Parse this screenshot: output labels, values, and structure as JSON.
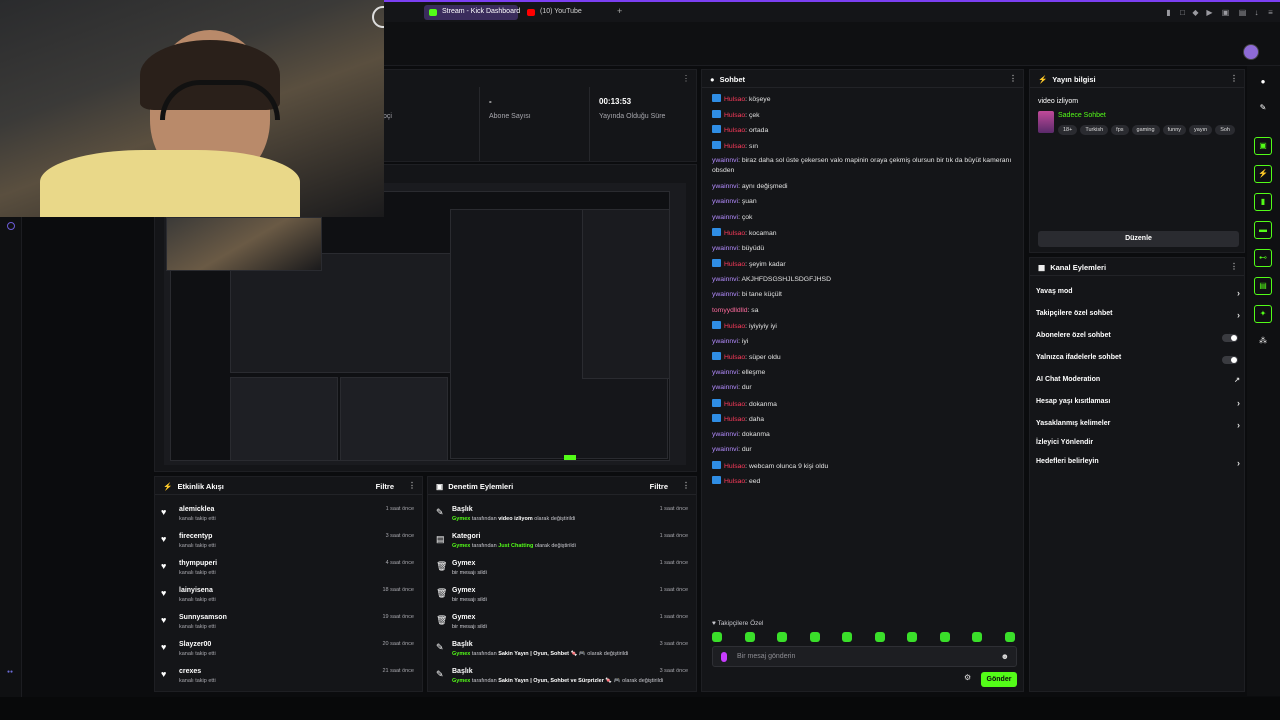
{
  "browser": {
    "tabs": [
      {
        "label": "Stream - Kick Dashboard"
      },
      {
        "label": "(10) YouTube"
      }
    ]
  },
  "stats": [
    {
      "value": "",
      "label": "akipçi"
    },
    {
      "value": "-",
      "label": "Abone Sayısı"
    },
    {
      "value": "00:13:53",
      "label": "Yayında Olduğu Süre"
    }
  ],
  "activity": {
    "title": "Etkinlik Akışı",
    "filter": "Filtre",
    "items": [
      {
        "name": "alemicklea",
        "sub": "kanalı takip etti",
        "time": "1 saat önce"
      },
      {
        "name": "firecentyp",
        "sub": "kanalı takip etti",
        "time": "3 saat önce"
      },
      {
        "name": "thympuperi",
        "sub": "kanalı takip etti",
        "time": "4 saat önce"
      },
      {
        "name": "lainyisena",
        "sub": "kanalı takip etti",
        "time": "18 saat önce"
      },
      {
        "name": "Sunnysamson",
        "sub": "kanalı takip etti",
        "time": "19 saat önce"
      },
      {
        "name": "Slayzer00",
        "sub": "kanalı takip etti",
        "time": "20 saat önce"
      },
      {
        "name": "crexes",
        "sub": "kanalı takip etti",
        "time": "21 saat önce"
      }
    ]
  },
  "moderation": {
    "title": "Denetim Eylemleri",
    "filter": "Filtre",
    "items": [
      {
        "title": "Başlık",
        "user": "Gymex",
        "pre": " tarafından ",
        "highlight": "video izliyom",
        "post": " olarak değiştirildi",
        "time": "1 saat önce"
      },
      {
        "title": "Kategori",
        "user": "Gymex",
        "pre": " tarafından ",
        "highlight": "Just Chatting",
        "post": " olarak değiştirildi",
        "time": "1 saat önce"
      },
      {
        "title": "Gymex",
        "user": "",
        "pre": "bir mesajı sildi",
        "highlight": "",
        "post": "",
        "time": "1 saat önce"
      },
      {
        "title": "Gymex",
        "user": "",
        "pre": "bir mesajı sildi",
        "highlight": "",
        "post": "",
        "time": "1 saat önce"
      },
      {
        "title": "Gymex",
        "user": "",
        "pre": "bir mesajı sildi",
        "highlight": "",
        "post": "",
        "time": "1 saat önce"
      },
      {
        "title": "Başlık",
        "user": "Gymex",
        "pre": " tarafından ",
        "highlight": "Sakin Yayın | Oyun, Sohbet",
        "post": " 🍬 🎮 olarak değiştirildi",
        "time": "3 saat önce"
      },
      {
        "title": "Başlık",
        "user": "Gymex",
        "pre": " tarafından ",
        "highlight": "Sakin Yayın | Oyun, Sohbet ve Sürprizler",
        "post": " 🍬 🎮 olarak değiştirildi",
        "time": "3 saat önce"
      }
    ]
  },
  "chat": {
    "title": "Sohbet",
    "messages": [
      {
        "badge": true,
        "user": "Hulsao",
        "color": "red",
        "text": ": köşeye"
      },
      {
        "badge": true,
        "user": "Hulsao",
        "color": "red",
        "text": ": çek"
      },
      {
        "badge": true,
        "user": "Hulsao",
        "color": "red",
        "text": ": ortada"
      },
      {
        "badge": true,
        "user": "Hulsao",
        "color": "red",
        "text": ": sın"
      },
      {
        "badge": false,
        "user": "ywainnvi",
        "color": "purple",
        "text": ": biraz daha sol üste çekersen valo mapinin oraya çekmiş olursun bir tık da büyüt kameranı obsden"
      },
      {
        "badge": false,
        "user": "ywainnvi",
        "color": "purple",
        "text": ": aynı değişmedi"
      },
      {
        "badge": false,
        "user": "ywainnvi",
        "color": "purple",
        "text": ": şuan"
      },
      {
        "badge": false,
        "user": "ywainnvi",
        "color": "purple",
        "text": ": çok"
      },
      {
        "badge": true,
        "user": "Hulsao",
        "color": "red",
        "text": ": kocaman"
      },
      {
        "badge": false,
        "user": "ywainnvi",
        "color": "purple",
        "text": ": büyüdü"
      },
      {
        "badge": true,
        "user": "Hulsao",
        "color": "red",
        "text": ": şeyim kadar"
      },
      {
        "badge": false,
        "user": "ywainnvi",
        "color": "purple",
        "text": ": AKJHFDSGSHJLSDGFJHSD"
      },
      {
        "badge": false,
        "user": "ywainnvi",
        "color": "purple",
        "text": ": bi tane küçült"
      },
      {
        "badge": false,
        "user": "tomyydlldlld",
        "color": "pink",
        "text": ": sa"
      },
      {
        "badge": true,
        "user": "Hulsao",
        "color": "red",
        "text": ": iyiyiyiy iyi"
      },
      {
        "badge": false,
        "user": "ywainnvi",
        "color": "purple",
        "text": ": iyi"
      },
      {
        "badge": true,
        "user": "Hulsao",
        "color": "red",
        "text": ": süper oldu"
      },
      {
        "badge": false,
        "user": "ywainnvi",
        "color": "purple",
        "text": ": elleşme"
      },
      {
        "badge": false,
        "user": "ywainnvi",
        "color": "purple",
        "text": ": dur"
      },
      {
        "badge": true,
        "user": "Hulsao",
        "color": "red",
        "text": ": dokanma"
      },
      {
        "badge": true,
        "user": "Hulsao",
        "color": "red",
        "text": ": daha"
      },
      {
        "badge": false,
        "user": "ywainnvi",
        "color": "purple",
        "text": ": dokanma"
      },
      {
        "badge": false,
        "user": "ywainnvi",
        "color": "purple",
        "text": ": dur"
      },
      {
        "badge": true,
        "user": "Hulsao",
        "color": "red",
        "text": ": webcam olunca 9 kişi oldu"
      },
      {
        "badge": true,
        "user": "Hulsao",
        "color": "red",
        "text": ": eed"
      }
    ],
    "mode_label": "Takipçilere Özel",
    "input_placeholder": "Bir mesaj gönderin",
    "send_label": "Gönder"
  },
  "stream_info": {
    "title": "Yayın bilgisi",
    "stream_title": "video izliyom",
    "category": "Sadece Sohbet",
    "tags": [
      "18+",
      "Turkish",
      "fps",
      "gaming",
      "funny",
      "yayın",
      "Soh"
    ],
    "edit_label": "Düzenle"
  },
  "channel_actions": {
    "title": "Kanal Eylemleri",
    "rows": [
      {
        "label": "Yavaş mod",
        "control": "chevron"
      },
      {
        "label": "Takipçilere özel sohbet",
        "control": "chevron"
      },
      {
        "label": "Abonelere özel sohbet",
        "control": "toggle"
      },
      {
        "label": "Yalnızca ifadelerle sohbet",
        "control": "toggle"
      },
      {
        "label": "AI Chat Moderation",
        "control": "external"
      },
      {
        "label": "Hesap yaşı kısıtlaması",
        "control": "chevron"
      },
      {
        "label": "Yasaklanmış kelimeler",
        "control": "chevron"
      },
      {
        "label": "İzleyici Yönlendir",
        "control": "none"
      },
      {
        "label": "Hedefleri belirleyin",
        "control": "chevron"
      }
    ]
  },
  "colors": {
    "accent": "#53fc18",
    "tab_active": "#3a2c5c",
    "panel": "#141518"
  }
}
